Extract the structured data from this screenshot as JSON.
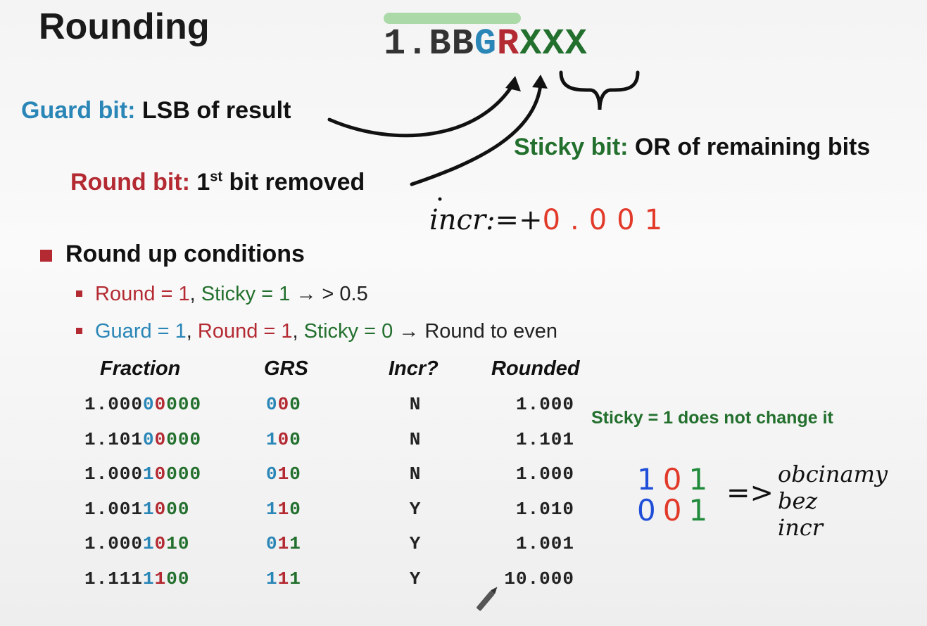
{
  "title": "Rounding",
  "format": {
    "prefix": "1.BB",
    "guard": "G",
    "round": "R",
    "sticky": "XXX"
  },
  "labels": {
    "guard_key": "Guard bit:",
    "guard_desc": " LSB of result",
    "round_key": "Round bit:",
    "round_desc_pre": " 1",
    "round_desc_sup": "st",
    "round_desc_post": " bit removed",
    "sticky_key": "Sticky bit:",
    "sticky_desc": " OR of remaining bits"
  },
  "section": "Round up conditions",
  "conditions": [
    {
      "round": "Round = 1",
      "sep1": ", ",
      "sticky": "Sticky = 1",
      "arrow": " → ",
      "result": "> 0.5"
    },
    {
      "guard": "Guard = 1",
      "sep0": ", ",
      "round": "Round = 1",
      "sep1": ", ",
      "sticky": "Sticky = 0",
      "arrow": " → ",
      "result": "Round to even"
    }
  ],
  "table": {
    "headers": [
      "Fraction",
      "GRS",
      "Incr?",
      "Rounded"
    ],
    "rows": [
      {
        "f_pre": "1.000",
        "f_g": "0",
        "f_r": "0",
        "f_s": "000",
        "grs_g": "0",
        "grs_r": "0",
        "grs_s": "0",
        "incr": "N",
        "rounded": "1.000"
      },
      {
        "f_pre": "1.101",
        "f_g": "0",
        "f_r": "0",
        "f_s": "000",
        "grs_g": "1",
        "grs_r": "0",
        "grs_s": "0",
        "incr": "N",
        "rounded": "1.101"
      },
      {
        "f_pre": "1.000",
        "f_g": "1",
        "f_r": "0",
        "f_s": "000",
        "grs_g": "0",
        "grs_r": "1",
        "grs_s": "0",
        "incr": "N",
        "rounded": "1.000"
      },
      {
        "f_pre": "1.001",
        "f_g": "1",
        "f_r": "0",
        "f_s": "00",
        "grs_g": "1",
        "grs_r": "1",
        "grs_s": "0",
        "incr": "Y",
        "rounded": "1.010"
      },
      {
        "f_pre": "1.000",
        "f_g": "1",
        "f_r": "0",
        "f_s": "10",
        "grs_g": "0",
        "grs_r": "1",
        "grs_s": "1",
        "incr": "Y",
        "rounded": "1.001"
      },
      {
        "f_pre": "1.111",
        "f_g": "1",
        "f_r": "1",
        "f_s": "00",
        "grs_g": "1",
        "grs_r": "1",
        "grs_s": "1",
        "incr": "Y",
        "rounded": "10.000"
      }
    ]
  },
  "note": "Sticky = 1 does not change it",
  "handwriting": {
    "incr": "incr:=+",
    "incr_value": "0.001",
    "bits_top": [
      "1",
      "0",
      "1"
    ],
    "bits_bottom": [
      "0",
      "0",
      "1"
    ],
    "implies": "=>",
    "comment_lines": [
      "obcinamy",
      "bez",
      "incr"
    ]
  },
  "colors": {
    "guard": "#2a86b7",
    "round": "#b42a32",
    "sticky": "#23702e",
    "ink": "#111111",
    "ink_red": "#e23a2a",
    "ink_blue": "#1f4fd8",
    "ink_green": "#1f8a3a"
  }
}
